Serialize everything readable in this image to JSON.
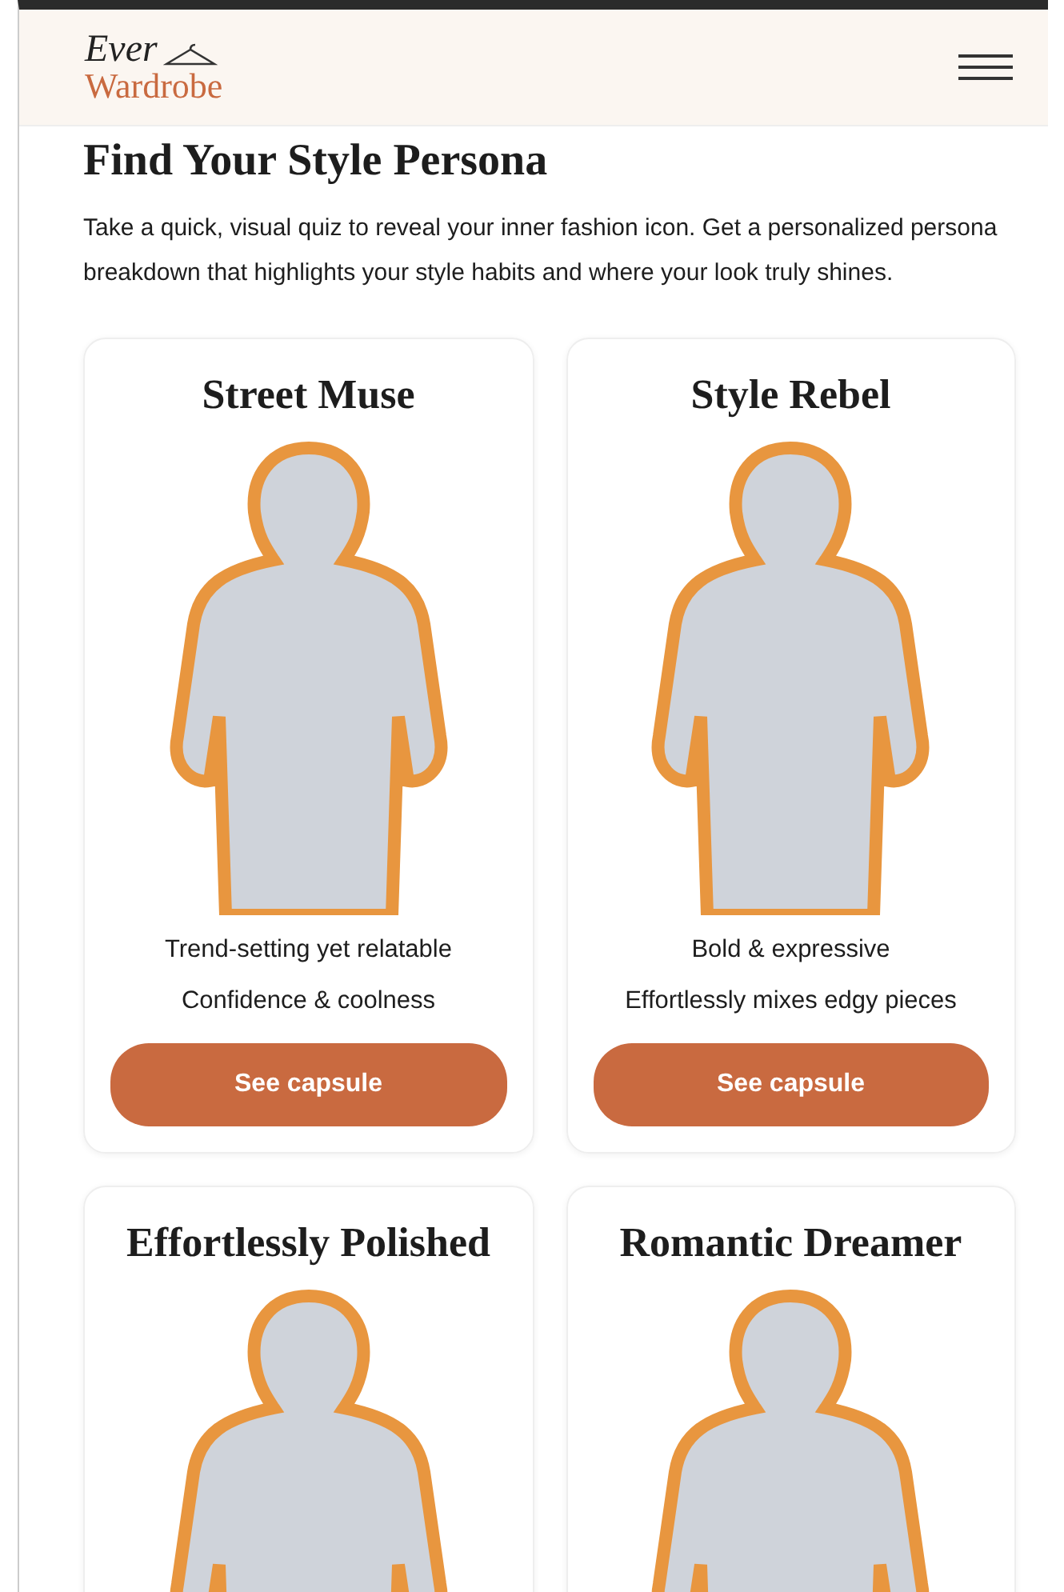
{
  "header": {
    "logo_top": "Ever",
    "logo_bottom": "Wardrobe"
  },
  "title": "Find Your Style Persona",
  "intro": "Take a quick, visual quiz to reveal your inner fashion icon. Get a personalized persona breakdown that highlights your style habits and where your look truly shines.",
  "personas": [
    {
      "name": "Street Muse",
      "traits": [
        "Trend-setting yet relatable",
        "Confidence & coolness"
      ],
      "button": "See capsule"
    },
    {
      "name": "Style Rebel",
      "traits": [
        "Bold & expressive",
        "Effortlessly mixes edgy pieces"
      ],
      "button": "See capsule"
    },
    {
      "name": "Effortlessly Polished"
    },
    {
      "name": "Romantic Dreamer"
    }
  ]
}
